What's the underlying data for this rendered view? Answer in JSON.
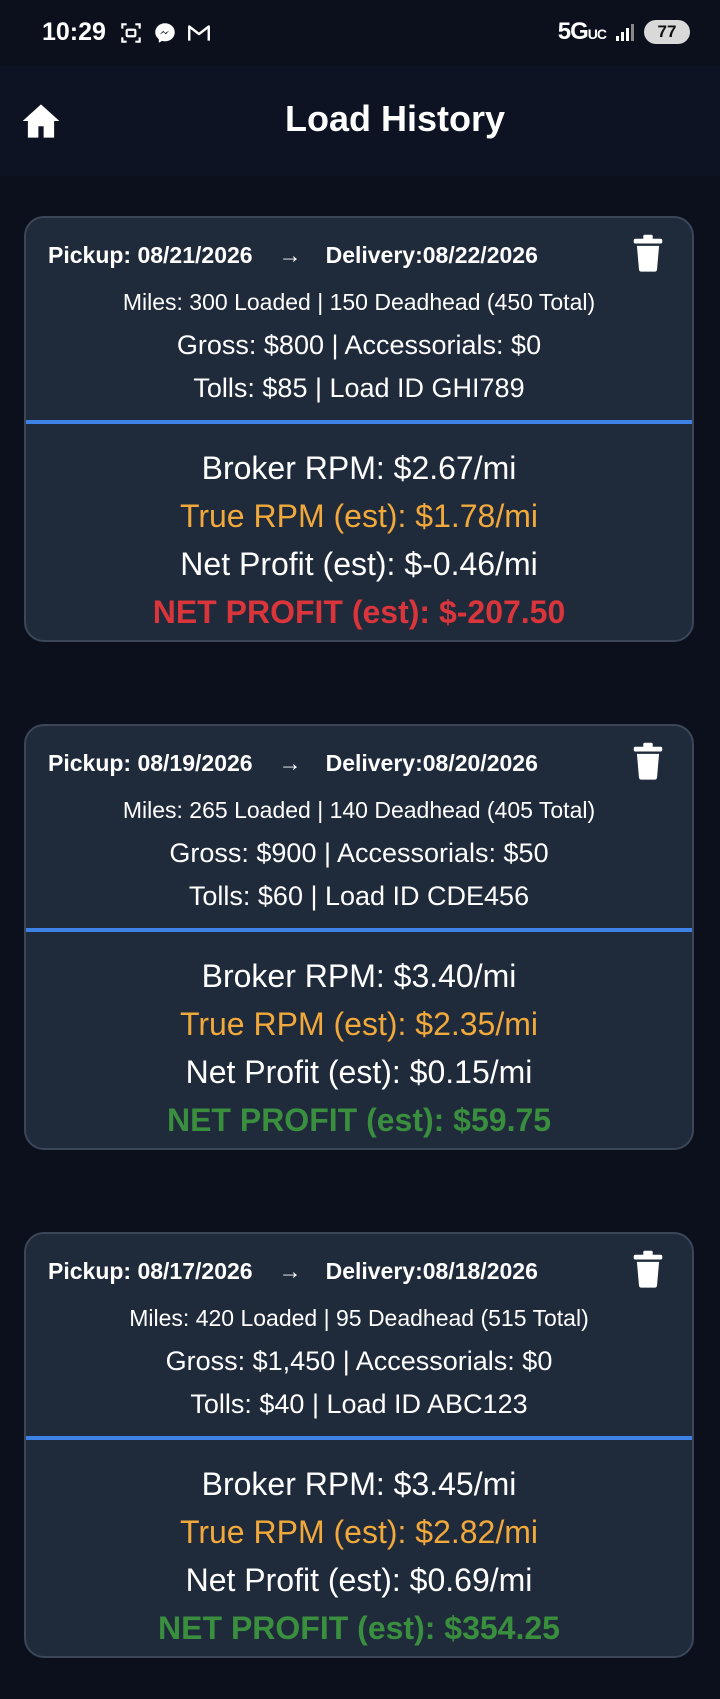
{
  "status_bar": {
    "time": "10:29",
    "network": "5G",
    "network_suffix": "UC",
    "battery": "77",
    "icons": [
      "screenshot-icon",
      "messenger-icon",
      "gmail-icon",
      "signal-icon"
    ]
  },
  "header": {
    "title": "Load History",
    "home_icon": "home-icon"
  },
  "colors": {
    "background": "#0b101c",
    "card": "#1f2a3b",
    "divider": "#3f82e6",
    "true_rpm": "#f2a93b",
    "negative": "#d9353b",
    "positive": "#3a8f3f"
  },
  "loads": [
    {
      "pickup": "Pickup: 08/21/2026",
      "arrow": "→",
      "delivery": "Delivery:08/22/2026",
      "miles": "Miles: 300 Loaded | 150 Deadhead  (450 Total)",
      "gross": "Gross: $800 | Accessorials: $0",
      "tolls": "Tolls: $85 |  Load ID GHI789",
      "broker_rpm": "Broker RPM: $2.67/mi",
      "true_rpm": "True RPM (est): $1.78/mi",
      "net_rate": "Net Profit (est): $-0.46/mi",
      "net_total": "NET PROFIT (est):  $-207.50",
      "profit_status": "negative"
    },
    {
      "pickup": "Pickup: 08/19/2026",
      "arrow": "→",
      "delivery": "Delivery:08/20/2026",
      "miles": "Miles: 265 Loaded | 140 Deadhead  (405 Total)",
      "gross": "Gross: $900 | Accessorials: $50",
      "tolls": "Tolls: $60 |  Load ID CDE456",
      "broker_rpm": "Broker RPM: $3.40/mi",
      "true_rpm": "True RPM (est): $2.35/mi",
      "net_rate": "Net Profit (est): $0.15/mi",
      "net_total": "NET PROFIT (est):  $59.75",
      "profit_status": "positive"
    },
    {
      "pickup": "Pickup: 08/17/2026",
      "arrow": "→",
      "delivery": "Delivery:08/18/2026",
      "miles": "Miles: 420 Loaded | 95 Deadhead  (515 Total)",
      "gross": "Gross: $1,450 | Accessorials: $0",
      "tolls": "Tolls: $40 |  Load ID ABC123",
      "broker_rpm": "Broker RPM: $3.45/mi",
      "true_rpm": "True RPM (est): $2.82/mi",
      "net_rate": "Net Profit (est): $0.69/mi",
      "net_total": "NET PROFIT (est):  $354.25",
      "profit_status": "positive"
    }
  ]
}
